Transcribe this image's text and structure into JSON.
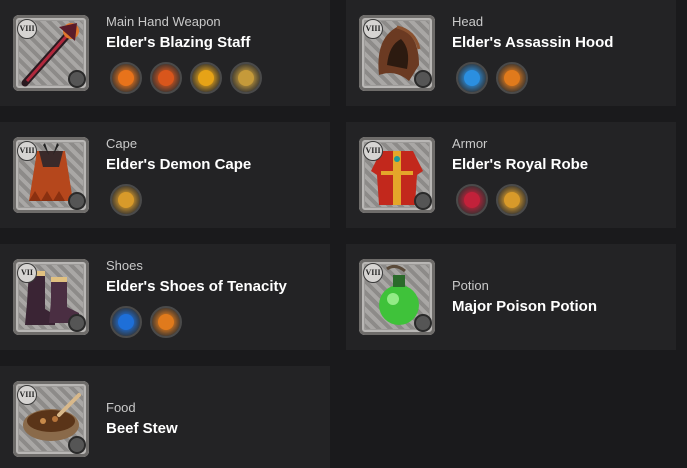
{
  "items": [
    {
      "type": "Main Hand Weapon",
      "name": "Elder's Blazing Staff",
      "tier": "VIII",
      "spells": [
        {
          "icon": "fire-burst-icon",
          "color": "#e8731b"
        },
        {
          "icon": "fire-ring-icon",
          "color": "#d9561c"
        },
        {
          "icon": "flame-spark-icon",
          "color": "#e6a317"
        },
        {
          "icon": "sword-passive-icon",
          "color": "#c59a3a"
        }
      ]
    },
    {
      "type": "Head",
      "name": "Elder's Assassin Hood",
      "tier": "VIII",
      "spells": [
        {
          "icon": "water-orb-icon",
          "color": "#2b8fe0"
        },
        {
          "icon": "fire-passive-icon",
          "color": "#e07a1c"
        }
      ]
    },
    {
      "type": "Cape",
      "name": "Elder's Demon Cape",
      "tier": "VIII",
      "spells": [
        {
          "icon": "sword-passive-icon",
          "color": "#d89a2a"
        }
      ]
    },
    {
      "type": "Armor",
      "name": "Elder's Royal Robe",
      "tier": "VIII",
      "spells": [
        {
          "icon": "blood-gear-icon",
          "color": "#c2213a"
        },
        {
          "icon": "sword-passive-icon",
          "color": "#d89a2a"
        }
      ]
    },
    {
      "type": "Shoes",
      "name": "Elder's Shoes of Tenacity",
      "tier": "VII",
      "spells": [
        {
          "icon": "blue-shield-icon",
          "color": "#1e6fd8"
        },
        {
          "icon": "fire-passive-icon",
          "color": "#e07a1c"
        }
      ]
    },
    {
      "type": "Potion",
      "name": "Major Poison Potion",
      "tier": "VIII",
      "spells": []
    },
    {
      "type": "Food",
      "name": "Beef Stew",
      "tier": "VIII",
      "spells": []
    }
  ]
}
